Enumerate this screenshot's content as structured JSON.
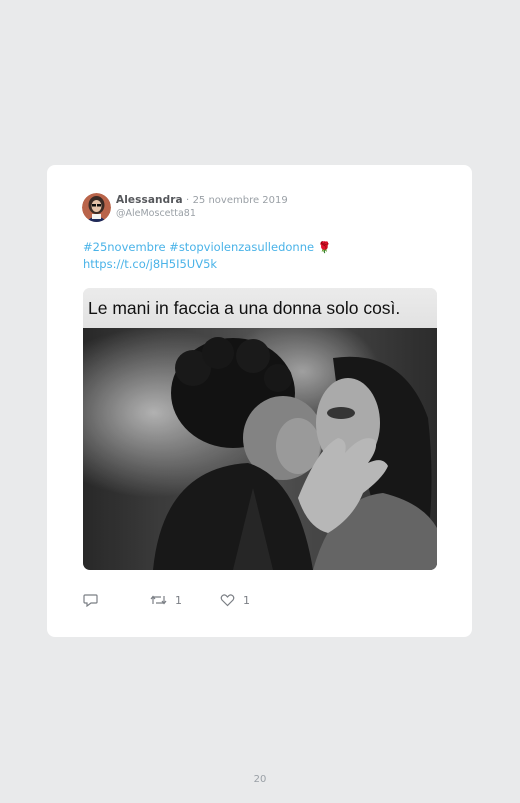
{
  "tweet": {
    "author_name": "Alessandra",
    "separator": "·",
    "date": "25 novembre 2019",
    "handle": "@AleMoscetta81",
    "hashtags": "#25novembre #stopviolenzasulledonne",
    "emoji": "🌹",
    "link": "https://t.co/j8H5I5UV5k",
    "media_caption": "Le mani in faccia a una donna solo così.",
    "retweets": "1",
    "likes": "1"
  },
  "icons": {
    "reply": "reply-icon",
    "retweet": "retweet-icon",
    "like": "heart-icon"
  },
  "colors": {
    "link": "#4ab3e8",
    "page_bg": "#e9eaeb",
    "card_bg": "#ffffff"
  },
  "page_number": "20"
}
